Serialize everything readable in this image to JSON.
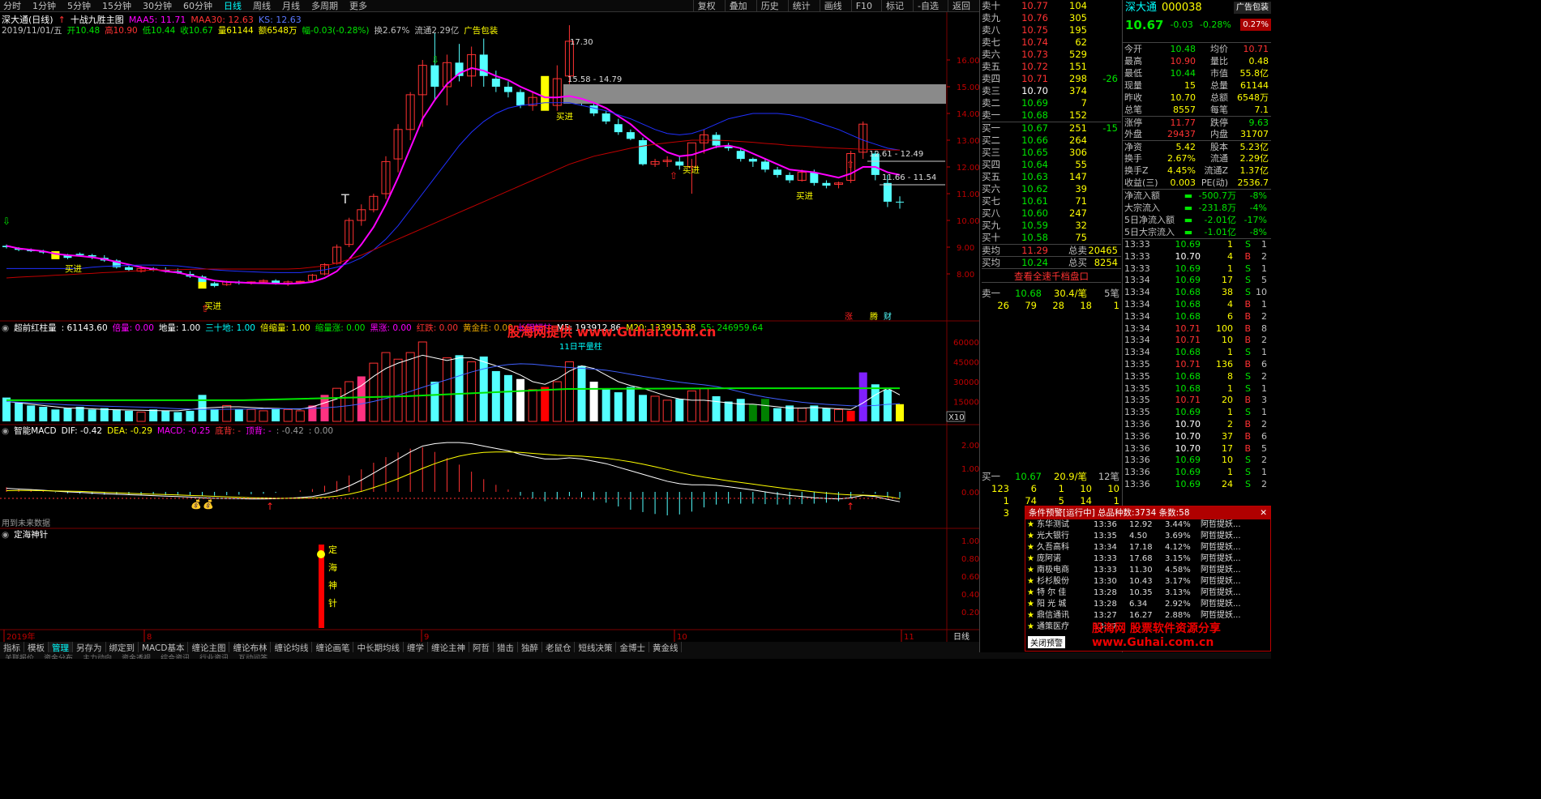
{
  "topbar": {
    "periods": [
      "分时",
      "1分钟",
      "5分钟",
      "15分钟",
      "30分钟",
      "60分钟",
      "日线",
      "周线",
      "月线",
      "多周期",
      "更多"
    ],
    "active": "日线",
    "buttons": [
      "复权",
      "叠加",
      "历史",
      "统计",
      "画线",
      "F10",
      "标记",
      "-自选",
      "返回"
    ]
  },
  "chart": {
    "title": "深大通(日线)",
    "strategy": "十战九胜主图",
    "ma5_label": "MAA5: 11.71",
    "ma30_label": "MAA30: 12.63",
    "ks_label": "KS: 12.63",
    "info": {
      "date": "2019/11/01/五",
      "open": "开10.48",
      "high": "高10.90",
      "low": "低10.44",
      "close": "收10.67",
      "vol": "量61144",
      "amt": "额6548万",
      "change": "幅-0.03(-0.28%)",
      "turnover": "换2.67%",
      "float": "流通2.29亿",
      "ad": "广告包装"
    },
    "price_ticks": [
      "16.00",
      "15.00",
      "14.00",
      "13.00",
      "12.00",
      "11.00",
      "10.00",
      "9.00",
      "8.00"
    ],
    "annot": {
      "high": "17.30",
      "range1": "15.58 - 14.79",
      "range2": "12.61 - 12.49",
      "range3": "11.66 - 11.54",
      "buy": "买进",
      "zhang": "涨",
      "teng": "腾",
      "cai": "财"
    }
  },
  "vol_panel": {
    "title": "超前红柱量",
    "value": ": 61143.60",
    "items": [
      "倍量: 0.00",
      "地量: 1.00",
      "三十地: 1.00",
      "倍缩量: 1.00",
      "缩量涨: 0.00",
      "黑涨: 0.00",
      "红跌: 0.00",
      "黄金柱: 0.00",
      "长阴短柱"
    ],
    "ma5": "M5: 193912.86",
    "ma20": "M20: 133915.38",
    "ma55": "55: 246959.64",
    "label11": "11日平量柱",
    "watermark": "股海网提供 www.Guhai.com.cn",
    "ticks": [
      "60000",
      "45000",
      "30000",
      "15000"
    ],
    "x10": "X10"
  },
  "macd_panel": {
    "title": "智能MACD",
    "dif": "DIF: -0.42",
    "dea": "DEA: -0.29",
    "macd": "MACD: -0.25",
    "di": "底背: -",
    "ding": "顶背: -",
    "extra": ": -0.42",
    "extra2": ": 0.00",
    "ticks": [
      "2.00",
      "1.00",
      "0.00"
    ],
    "future": "用到未来数据"
  },
  "zh_panel": {
    "title": "定海神针",
    "ticks": [
      "1.00",
      "0.80",
      "0.60",
      "0.40",
      "0.20"
    ],
    "chars": [
      "定",
      "海",
      "神",
      "针"
    ]
  },
  "dates": [
    "2019年",
    "8",
    "9",
    "10",
    "11"
  ],
  "date_label": "日线",
  "stock": {
    "name": "深大通",
    "code": "000038",
    "price": "10.67",
    "chg": "-0.03",
    "pct": "-0.28%",
    "ad": "广告包装",
    "adpct": "0.27%"
  },
  "asks": [
    {
      "l": "卖十",
      "p": "10.77",
      "v": "104"
    },
    {
      "l": "卖九",
      "p": "10.76",
      "v": "305"
    },
    {
      "l": "卖八",
      "p": "10.75",
      "v": "195"
    },
    {
      "l": "卖七",
      "p": "10.74",
      "v": "62"
    },
    {
      "l": "卖六",
      "p": "10.73",
      "v": "529"
    },
    {
      "l": "卖五",
      "p": "10.72",
      "v": "151"
    },
    {
      "l": "卖四",
      "p": "10.71",
      "v": "298",
      "d": "-26"
    },
    {
      "l": "卖三",
      "p": "10.70",
      "v": "374"
    },
    {
      "l": "卖二",
      "p": "10.69",
      "v": "7"
    },
    {
      "l": "卖一",
      "p": "10.68",
      "v": "152"
    }
  ],
  "bids": [
    {
      "l": "买一",
      "p": "10.67",
      "v": "251",
      "d": "-15"
    },
    {
      "l": "买二",
      "p": "10.66",
      "v": "264"
    },
    {
      "l": "买三",
      "p": "10.65",
      "v": "306"
    },
    {
      "l": "买四",
      "p": "10.64",
      "v": "55"
    },
    {
      "l": "买五",
      "p": "10.63",
      "v": "147"
    },
    {
      "l": "买六",
      "p": "10.62",
      "v": "39"
    },
    {
      "l": "买七",
      "p": "10.61",
      "v": "71"
    },
    {
      "l": "买八",
      "p": "10.60",
      "v": "247"
    },
    {
      "l": "买九",
      "p": "10.59",
      "v": "32"
    },
    {
      "l": "买十",
      "p": "10.58",
      "v": "75"
    }
  ],
  "avg": {
    "sell_label": "卖均",
    "sell": "11.29",
    "total_sell_label": "总卖",
    "total_sell": "20465",
    "buy_label": "买均",
    "buy": "10.24",
    "total_buy_label": "总买",
    "total_buy": "8254"
  },
  "full_depth": "查看全速千档盘口",
  "sell1": {
    "l": "卖一",
    "p": "10.68",
    "per": "30.4/笔",
    "cnt": "5笔",
    "q": [
      "26",
      "79",
      "28",
      "18",
      "1"
    ]
  },
  "buy1": {
    "l": "买一",
    "p": "10.67",
    "per": "20.9/笔",
    "cnt": "12笔",
    "q": [
      "123",
      "6",
      "1",
      "10",
      "10",
      "1",
      "74",
      "5",
      "14",
      "1",
      "3",
      "2"
    ]
  },
  "quote": [
    {
      "a": "今开",
      "av": "10.48",
      "b": "均价",
      "bv": "10.71"
    },
    {
      "a": "最高",
      "av": "10.90",
      "b": "量比",
      "bv": "0.48"
    },
    {
      "a": "最低",
      "av": "10.44",
      "b": "市值",
      "bv": "55.8亿"
    },
    {
      "a": "现量",
      "av": "15",
      "b": "总量",
      "bv": "61144"
    },
    {
      "a": "昨收",
      "av": "10.70",
      "b": "总额",
      "bv": "6548万"
    },
    {
      "a": "总笔",
      "av": "8557",
      "b": "每笔",
      "bv": "7.1"
    },
    {
      "a": "涨停",
      "av": "11.77",
      "b": "跌停",
      "bv": "9.63"
    },
    {
      "a": "外盘",
      "av": "29437",
      "b": "内盘",
      "bv": "31707"
    },
    {
      "a": "净资",
      "av": "5.42",
      "b": "股本",
      "bv": "5.23亿"
    },
    {
      "a": "换手",
      "av": "2.67%",
      "b": "流通",
      "bv": "2.29亿"
    },
    {
      "a": "换手Z",
      "av": "4.45%",
      "b": "流通Z",
      "bv": "1.37亿"
    },
    {
      "a": "收益(三)",
      "av": "0.003",
      "b": "PE(动)",
      "bv": "2536.7"
    }
  ],
  "flows": [
    {
      "a": "净流入额",
      "v": "-500.7万",
      "p": "-8%"
    },
    {
      "a": "大宗流入",
      "v": "-231.8万",
      "p": "-4%"
    },
    {
      "a": "5日净流入额",
      "v": "-2.01亿",
      "p": "-17%"
    },
    {
      "a": "5日大宗流入",
      "v": "-1.01亿",
      "p": "-8%"
    }
  ],
  "ticks": [
    [
      "13:33",
      "10.69",
      "1",
      "S",
      "1"
    ],
    [
      "13:33",
      "10.70",
      "4",
      "B",
      "2"
    ],
    [
      "13:33",
      "10.69",
      "1",
      "S",
      "1"
    ],
    [
      "13:34",
      "10.69",
      "17",
      "S",
      "5"
    ],
    [
      "13:34",
      "10.68",
      "38",
      "S",
      "10"
    ],
    [
      "13:34",
      "10.68",
      "4",
      "B",
      "1"
    ],
    [
      "13:34",
      "10.68",
      "6",
      "B",
      "2"
    ],
    [
      "13:34",
      "10.71",
      "100",
      "B",
      "8"
    ],
    [
      "13:34",
      "10.71",
      "10",
      "B",
      "2"
    ],
    [
      "13:34",
      "10.68",
      "1",
      "S",
      "1"
    ],
    [
      "13:35",
      "10.71",
      "136",
      "B",
      "6"
    ],
    [
      "13:35",
      "10.68",
      "8",
      "S",
      "2"
    ],
    [
      "13:35",
      "10.68",
      "1",
      "S",
      "1"
    ],
    [
      "13:35",
      "10.71",
      "20",
      "B",
      "3"
    ],
    [
      "13:35",
      "10.69",
      "1",
      "S",
      "1"
    ],
    [
      "13:36",
      "10.70",
      "2",
      "B",
      "2"
    ],
    [
      "13:36",
      "10.70",
      "37",
      "B",
      "6"
    ],
    [
      "13:36",
      "10.70",
      "17",
      "B",
      "5"
    ],
    [
      "13:36",
      "10.69",
      "10",
      "S",
      "2"
    ],
    [
      "13:36",
      "10.69",
      "1",
      "S",
      "1"
    ],
    [
      "13:36",
      "10.69",
      "24",
      "S",
      "2"
    ]
  ],
  "alert": {
    "title": "条件预警[运行中] 总品种数:3734 条数:58",
    "close": "关闭预警",
    "rows": [
      [
        "东华测试",
        "13:36",
        "12.92",
        "3.44%",
        "阿哲提妖..."
      ],
      [
        "光大银行",
        "13:35",
        "4.50",
        "3.69%",
        "阿哲提妖..."
      ],
      [
        "久吾高科",
        "13:34",
        "17.18",
        "4.12%",
        "阿哲提妖..."
      ],
      [
        "庞阿诺",
        "13:33",
        "17.68",
        "3.15%",
        "阿哲提妖..."
      ],
      [
        "南极电商",
        "13:33",
        "11.30",
        "4.58%",
        "阿哲提妖..."
      ],
      [
        "杉杉股份",
        "13:30",
        "10.43",
        "3.17%",
        "阿哲提妖..."
      ],
      [
        "特 尔 佳",
        "13:28",
        "10.35",
        "3.13%",
        "阿哲提妖..."
      ],
      [
        "阳 光 城",
        "13:28",
        "6.34",
        "2.92%",
        "阿哲提妖..."
      ],
      [
        "鼎信通讯",
        "13:27",
        "16.27",
        "2.88%",
        "阿哲提妖..."
      ],
      [
        "通策医疗",
        "13:27",
        "",
        "",
        ""
      ]
    ],
    "watermark": "股海网 股票软件资源分享 www.Guhai.com.cn"
  },
  "bottom_tabs": [
    "指标",
    "模板",
    "管理",
    "另存为",
    "绑定到",
    "MACD基本",
    "缠论主图",
    "缠论布林",
    "缠论均线",
    "缠论画笔",
    "中长期均线",
    "缠学",
    "缠论主神",
    "阿哲",
    "猎击",
    "独醉",
    "老鼠仓",
    "短线决策",
    "金博士",
    "黄金线"
  ],
  "bottom_active": "管理",
  "bottom2": [
    "关联报价",
    "资金分布",
    "主力动向",
    "资金透视",
    "综合资讯",
    "行业资讯",
    "互动问答"
  ],
  "colors": {
    "up": "#ff3232",
    "down": "#54ffff",
    "ma5": "#ff00ff",
    "ma30": "#2030ff",
    "ks": "#c00000",
    "macd_dif": "#ffffff",
    "macd_dea": "#ffff00"
  }
}
